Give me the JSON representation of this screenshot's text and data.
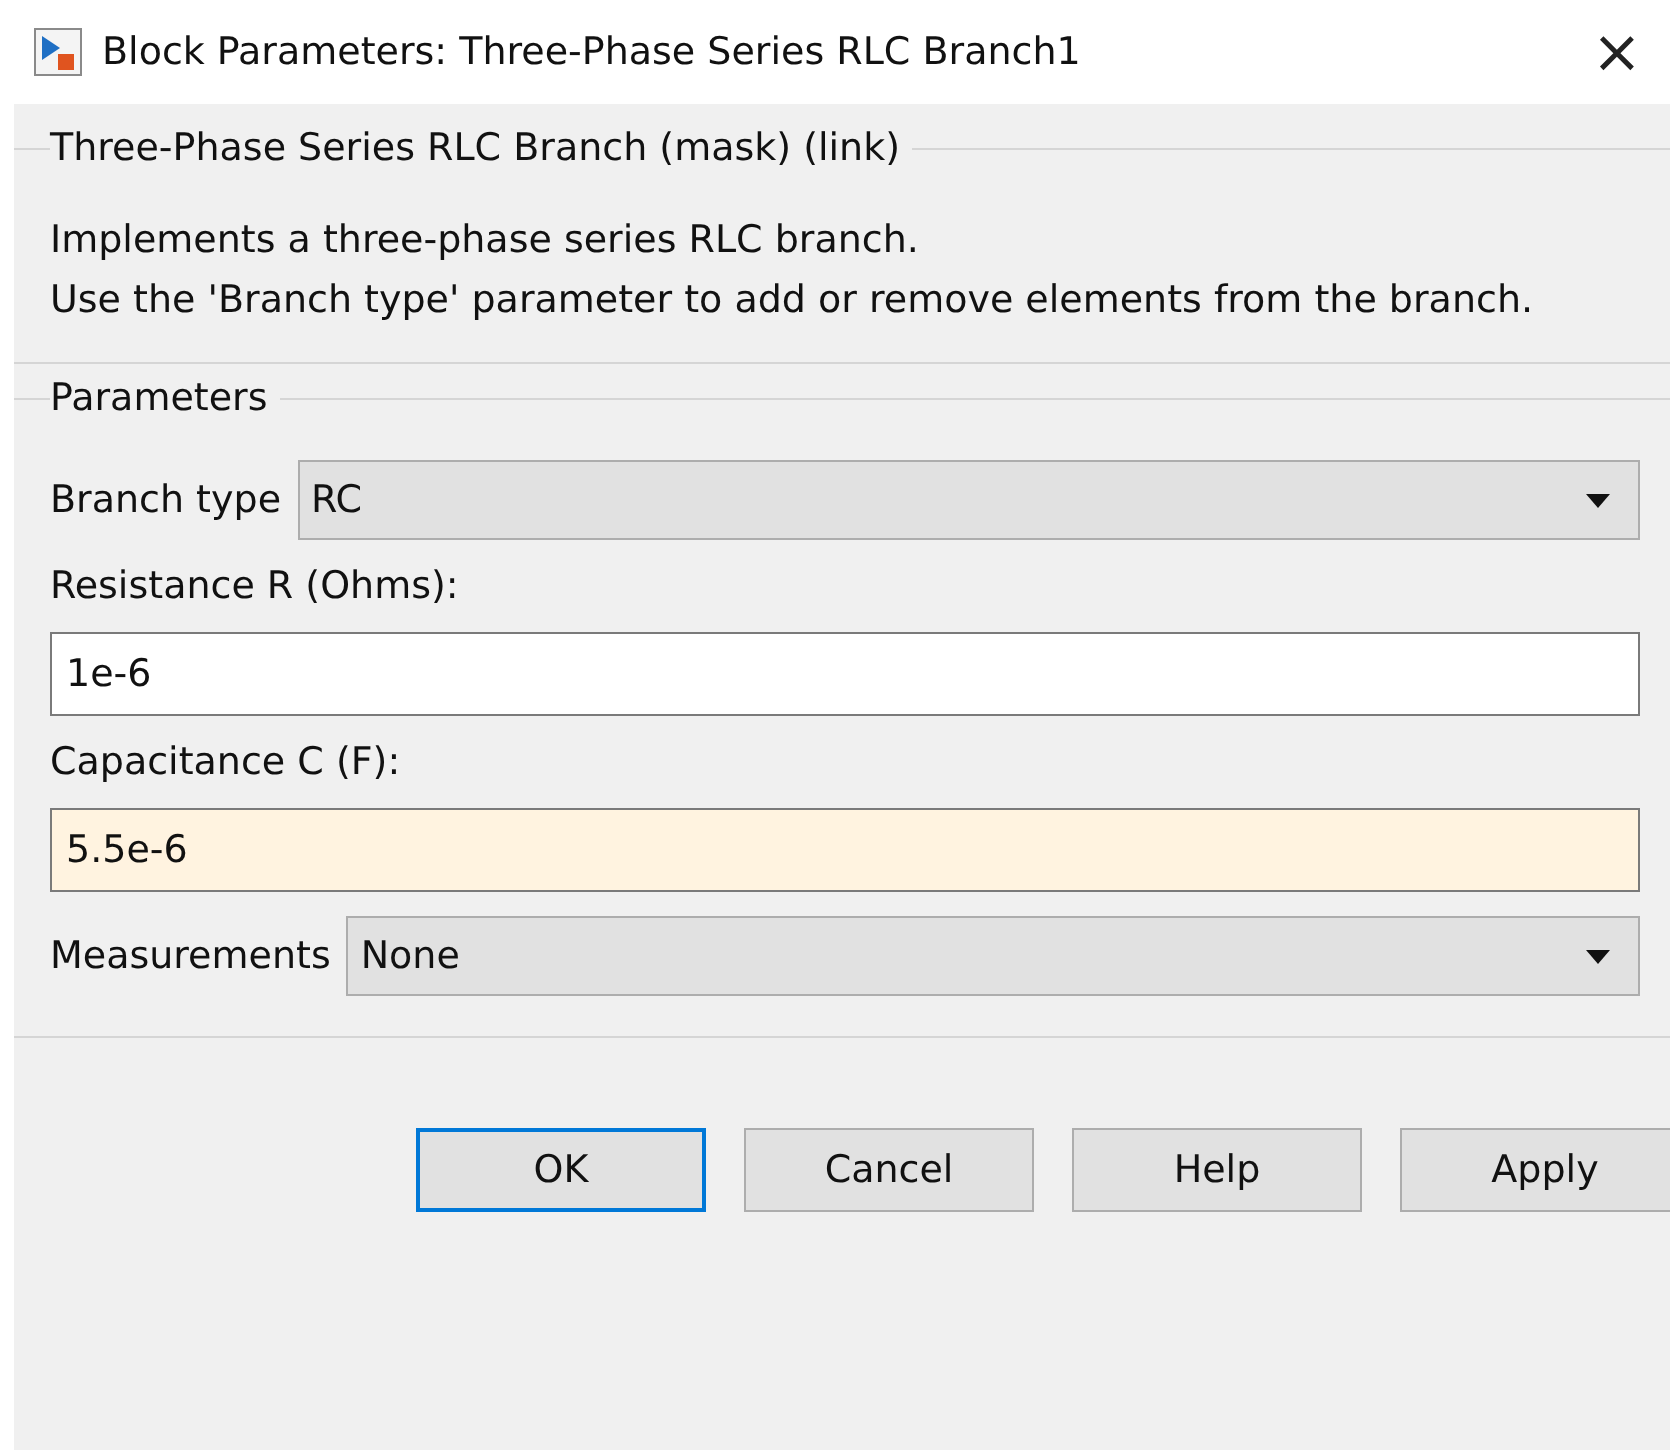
{
  "window": {
    "title": "Block Parameters: Three-Phase Series RLC Branch1",
    "close": "×"
  },
  "description": {
    "title": "Three-Phase Series RLC Branch (mask) (link)",
    "lines": [
      "Implements a three-phase series RLC branch.",
      "Use the 'Branch type' parameter to add or remove elements from the branch."
    ]
  },
  "parameters": {
    "title": "Parameters",
    "items": [
      {
        "kind": "dropdown",
        "label": "Branch type",
        "value": "RC"
      },
      {
        "kind": "text",
        "label": "Resistance R (Ohms):",
        "value": "1e-6",
        "highlighted": false
      },
      {
        "kind": "text",
        "label": "Capacitance C (F):",
        "value": "5.5e-6",
        "highlighted": true
      },
      {
        "kind": "dropdown",
        "label": "Measurements",
        "value": "None"
      }
    ]
  },
  "buttons": [
    {
      "label": "OK",
      "default": true
    },
    {
      "label": "Cancel",
      "default": false
    },
    {
      "label": "Help",
      "default": false
    },
    {
      "label": "Apply",
      "default": false
    }
  ]
}
